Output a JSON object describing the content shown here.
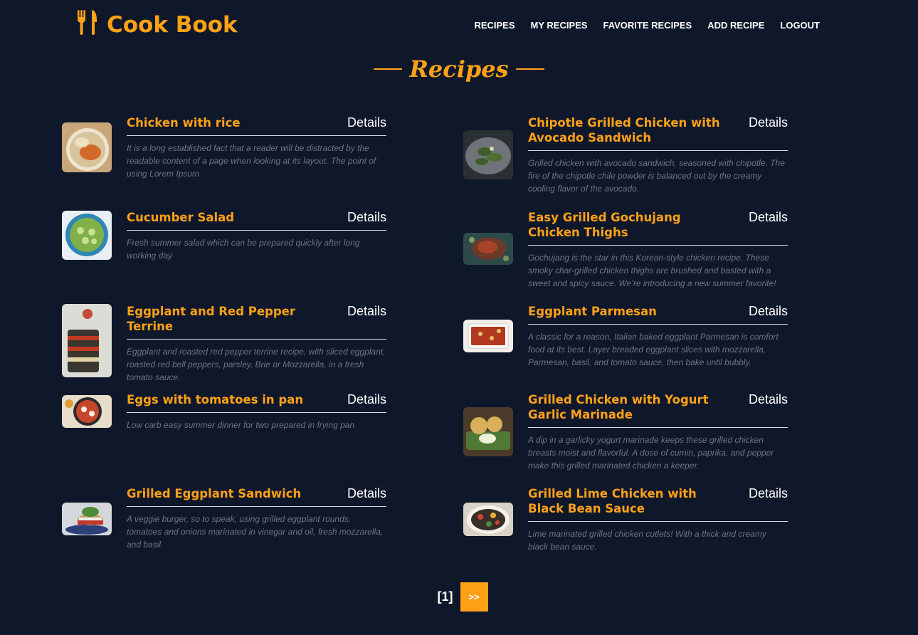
{
  "brand": {
    "name": "Cook Book",
    "icon": "utensils-icon",
    "color": "#fea116"
  },
  "nav": {
    "recipes": "RECIPES",
    "my_recipes": "MY RECIPES",
    "favorite_recipes": "FAVORITE RECIPES",
    "add_recipe": "ADD RECIPE",
    "logout": "LOGOUT"
  },
  "section": {
    "title": "Recipes"
  },
  "recipes_left": [
    {
      "title": "Chicken with rice",
      "details": "Details",
      "description": "It is a long established fact that a reader will be distracted by the readable content of a page when looking at its layout. The point of using Lorem Ipsum"
    },
    {
      "title": "Cucumber Salad",
      "details": "Details",
      "description": "Fresh summer salad which can be prepared quickly after long working day"
    },
    {
      "title": "Eggplant and Red Pepper Terrine",
      "details": "Details",
      "description": "Eggplant and roasted red pepper terrine recipe, with sliced eggplant, roasted red bell peppers, parsley, Brie or Mozzarella, in a fresh tomato sauce."
    },
    {
      "title": "Eggs with tomatoes in pan",
      "details": "Details",
      "description": "Low carb easy summer dinner for two prepared in frying pan"
    },
    {
      "title": "Grilled Eggplant Sandwich",
      "details": "Details",
      "description": "A veggie burger, so to speak, using grilled eggplant rounds, tomatoes and onions marinated in vinegar and oil, fresh mozzarella, and basil."
    }
  ],
  "recipes_right": [
    {
      "title": "Chipotle Grilled Chicken with Avocado Sandwich",
      "details": "Details",
      "description": "Grilled chicken with avocado sandwich, seasoned with chipotle. The fire of the chipotle chile powder is balanced out by the creamy cooling flavor of the avocado."
    },
    {
      "title": "Easy Grilled Gochujang Chicken Thighs",
      "details": "Details",
      "description": "Gochujang is the star in this Korean-style chicken recipe. These smoky char-grilled chicken thighs are brushed and basted with a sweet and spicy sauce. We’re introducing a new summer favorite!"
    },
    {
      "title": "Eggplant Parmesan",
      "details": "Details",
      "description": "A classic for a reason, Italian baked eggplant Parmesan is comfort food at its best. Layer breaded eggplant slices with mozzarella, Parmesan, basil, and tomato sauce, then bake until bubbly."
    },
    {
      "title": "Grilled Chicken with Yogurt Garlic Marinade",
      "details": "Details",
      "description": "A dip in a garlicky yogurt marinade keeps these grilled chicken breasts moist and flavorful. A dose of cumin, paprika, and pepper make this grilled marinated chicken a keeper."
    },
    {
      "title": "Grilled Lime Chicken with Black Bean Sauce",
      "details": "Details",
      "description": "Lime marinated grilled chicken cutlets! With a thick and creamy black bean sauce."
    }
  ],
  "pager": {
    "current": "[1]",
    "next": ">>"
  }
}
